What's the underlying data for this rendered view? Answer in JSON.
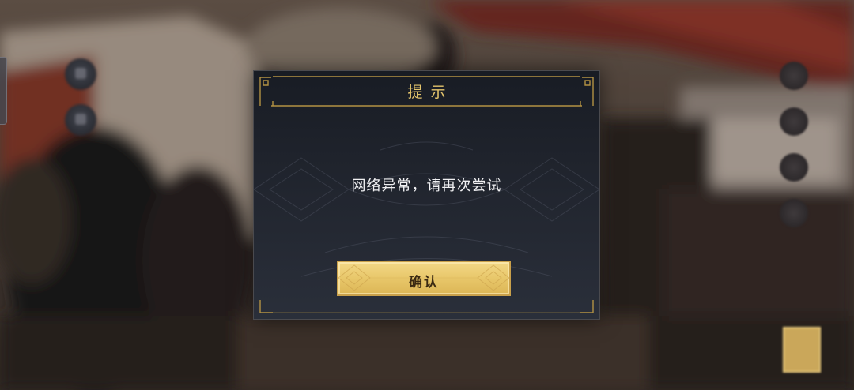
{
  "dialog": {
    "title": "提示",
    "message": "网络异常，请再次尝试",
    "confirm_label": "确认"
  },
  "colors": {
    "title_gold": "#e2c36b",
    "button_gold": "#e8c76a",
    "dialog_bg": "#1f232c"
  }
}
